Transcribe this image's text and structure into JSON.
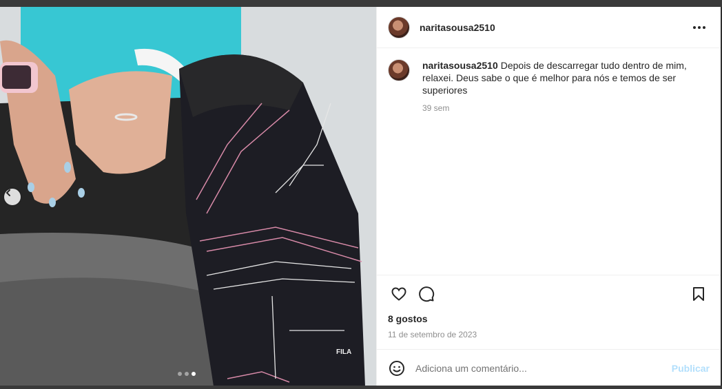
{
  "post": {
    "username": "naritasousa2510",
    "caption_username": "naritasousa2510",
    "caption_text": "Depois de descarregar tudo dentro de mim, relaxei. Deus sabe o que é melhor para nós e temos de ser superiores",
    "caption_time": "39 sem",
    "likes": "8 gostos",
    "date": "11 de setembro de 2023",
    "image_brand_text": "FILA"
  },
  "comment_box": {
    "placeholder": "Adiciona um comentário...",
    "publish_label": "Publicar"
  },
  "carousel": {
    "total": 3,
    "active_index": 2
  },
  "colors": {
    "publish_disabled": "#b2dffc",
    "meta_gray": "#8e8e8e",
    "text": "#262626"
  },
  "icons": [
    "more-options-icon",
    "heart-icon",
    "comment-icon",
    "bookmark-icon",
    "emoji-icon",
    "chevron-left-icon"
  ]
}
